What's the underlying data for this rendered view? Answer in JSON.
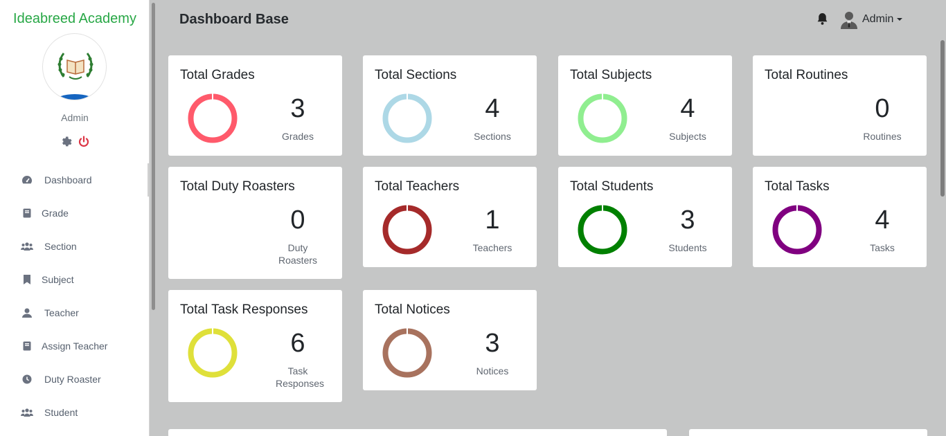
{
  "brand": "Ideabreed Academy",
  "admin": {
    "name": "Admin"
  },
  "topbar": {
    "title": "Dashboard Base",
    "user_label": "Admin"
  },
  "nav": [
    {
      "label": "Dashboard",
      "icon": "dashboard-icon"
    },
    {
      "label": "Grade",
      "icon": "book-icon"
    },
    {
      "label": "Section",
      "icon": "users-icon"
    },
    {
      "label": "Subject",
      "icon": "bookmark-icon"
    },
    {
      "label": "Teacher",
      "icon": "user-icon"
    },
    {
      "label": "Assign Teacher",
      "icon": "book-icon"
    },
    {
      "label": "Duty Roaster",
      "icon": "clock-icon"
    },
    {
      "label": "Student",
      "icon": "users-icon"
    }
  ],
  "cards": [
    {
      "title": "Total Grades",
      "count": "3",
      "unit": "Grades",
      "color": "#ff5a6b"
    },
    {
      "title": "Total Sections",
      "count": "4",
      "unit": "Sections",
      "color": "#add8e6"
    },
    {
      "title": "Total Subjects",
      "count": "4",
      "unit": "Subjects",
      "color": "#90ee90"
    },
    {
      "title": "Total Routines",
      "count": "0",
      "unit": "Routines",
      "color": ""
    },
    {
      "title": "Total Duty Roasters",
      "count": "0",
      "unit": "Duty Roasters",
      "color": ""
    },
    {
      "title": "Total Teachers",
      "count": "1",
      "unit": "Teachers",
      "color": "#a52a2a"
    },
    {
      "title": "Total Students",
      "count": "3",
      "unit": "Students",
      "color": "#008000"
    },
    {
      "title": "Total Tasks",
      "count": "4",
      "unit": "Tasks",
      "color": "#800080"
    },
    {
      "title": "Total Task Responses",
      "count": "6",
      "unit": "Task Responses",
      "color": "#dfe03a"
    },
    {
      "title": "Total Notices",
      "count": "3",
      "unit": "Notices",
      "color": "#a8725e"
    }
  ]
}
